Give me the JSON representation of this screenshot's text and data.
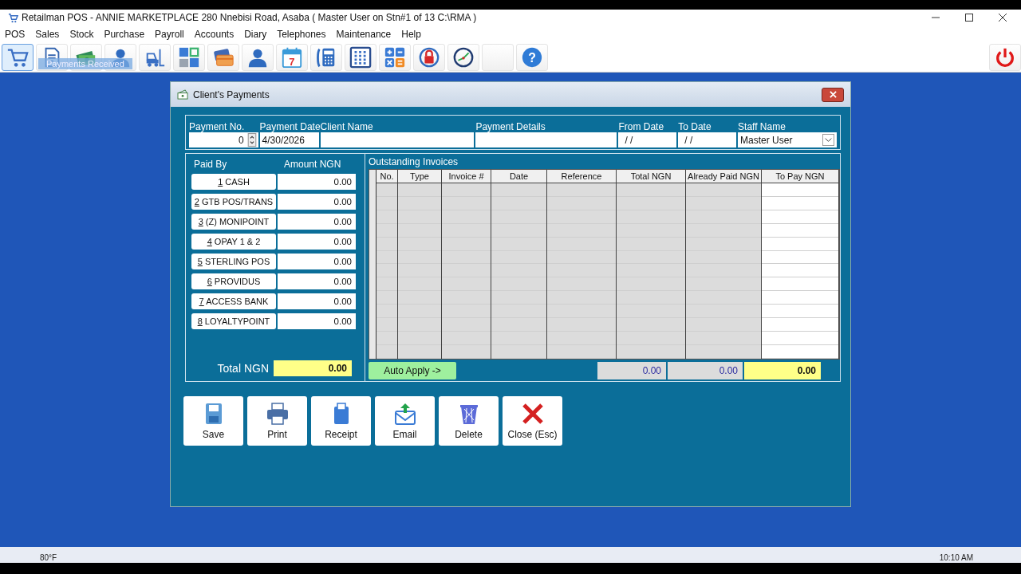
{
  "window": {
    "title": "Retailman POS - ANNIE MARKETPLACE 280 Nnebisi Road, Asaba ( Master User on Stn#1 of 13 C:\\RMA )"
  },
  "menu": [
    "POS",
    "Sales",
    "Stock",
    "Purchase",
    "Payroll",
    "Accounts",
    "Diary",
    "Telephones",
    "Maintenance",
    "Help"
  ],
  "toolbar": {
    "tooltip": "Payments Received",
    "buttons": [
      {
        "kind": "cart",
        "selected": true
      },
      {
        "kind": "document",
        "selected": false
      },
      {
        "kind": "money",
        "selected": false
      },
      {
        "kind": "person",
        "selected": false
      },
      {
        "kind": "forklift",
        "selected": false
      },
      {
        "kind": "tiles",
        "selected": false
      },
      {
        "kind": "cards",
        "selected": false
      },
      {
        "kind": "person",
        "selected": false
      },
      {
        "kind": "calendar",
        "label": "7",
        "selected": false
      },
      {
        "kind": "phone",
        "selected": false
      },
      {
        "kind": "grid",
        "selected": false
      },
      {
        "kind": "calculator",
        "selected": false
      },
      {
        "kind": "lock",
        "selected": false
      },
      {
        "kind": "gauge",
        "selected": false
      },
      {
        "kind": "blank",
        "selected": false
      },
      {
        "kind": "help",
        "label": "?",
        "selected": false
      }
    ]
  },
  "dialog": {
    "title": "Client's Payments",
    "fields": [
      {
        "kind": "spin",
        "label": "Payment No.",
        "value": "0"
      },
      {
        "kind": "text",
        "label": "Payment Date",
        "value": "4/30/2026"
      },
      {
        "kind": "wide",
        "label": "Client Name"
      },
      {
        "kind": "wide",
        "label": "Payment Details"
      },
      {
        "kind": "date",
        "label": "From Date",
        "value": "/ /"
      },
      {
        "kind": "date",
        "label": "To Date",
        "value": "/ /"
      },
      {
        "kind": "select",
        "label": "Staff Name",
        "value": "Master User"
      }
    ],
    "paid_by": {
      "header": "Paid By",
      "amount_header": "Amount NGN",
      "methods": [
        {
          "key": "1",
          "label": "CASH",
          "amount": "0.00"
        },
        {
          "key": "2",
          "label": "GTB POS/TRANS",
          "amount": "0.00"
        },
        {
          "key": "3",
          "label": "(Z) MONIPOINT",
          "amount": "0.00"
        },
        {
          "key": "4",
          "label": "OPAY 1 & 2",
          "amount": "0.00"
        },
        {
          "key": "5",
          "label": "STERLING POS",
          "amount": "0.00"
        },
        {
          "key": "6",
          "label": "PROVIDUS",
          "amount": "0.00"
        },
        {
          "key": "7",
          "label": "ACCESS BANK",
          "amount": "0.00"
        },
        {
          "key": "8",
          "label": "LOYALTYPOINT",
          "amount": "0.00"
        }
      ],
      "total_label": "Total NGN",
      "total": "0.00"
    },
    "invoices": {
      "title": "Outstanding Invoices",
      "columns": [
        "No.",
        "Type",
        "Invoice #",
        "Date",
        "Reference",
        "Total NGN",
        "Already Paid NGN",
        "To Pay NGN"
      ],
      "auto_apply": "Auto Apply ->",
      "totals": [
        "0.00",
        "0.00",
        "0.00"
      ]
    },
    "actions": [
      {
        "kind": "save",
        "label": "Save"
      },
      {
        "kind": "print",
        "label": "Print"
      },
      {
        "kind": "receipt",
        "label": "Receipt"
      },
      {
        "kind": "email",
        "label": "Email"
      },
      {
        "kind": "delete",
        "label": "Delete"
      },
      {
        "kind": "close",
        "label": "Close (Esc)"
      }
    ]
  },
  "taskbar": {
    "weather": "80°F",
    "time": "10:10 AM"
  }
}
